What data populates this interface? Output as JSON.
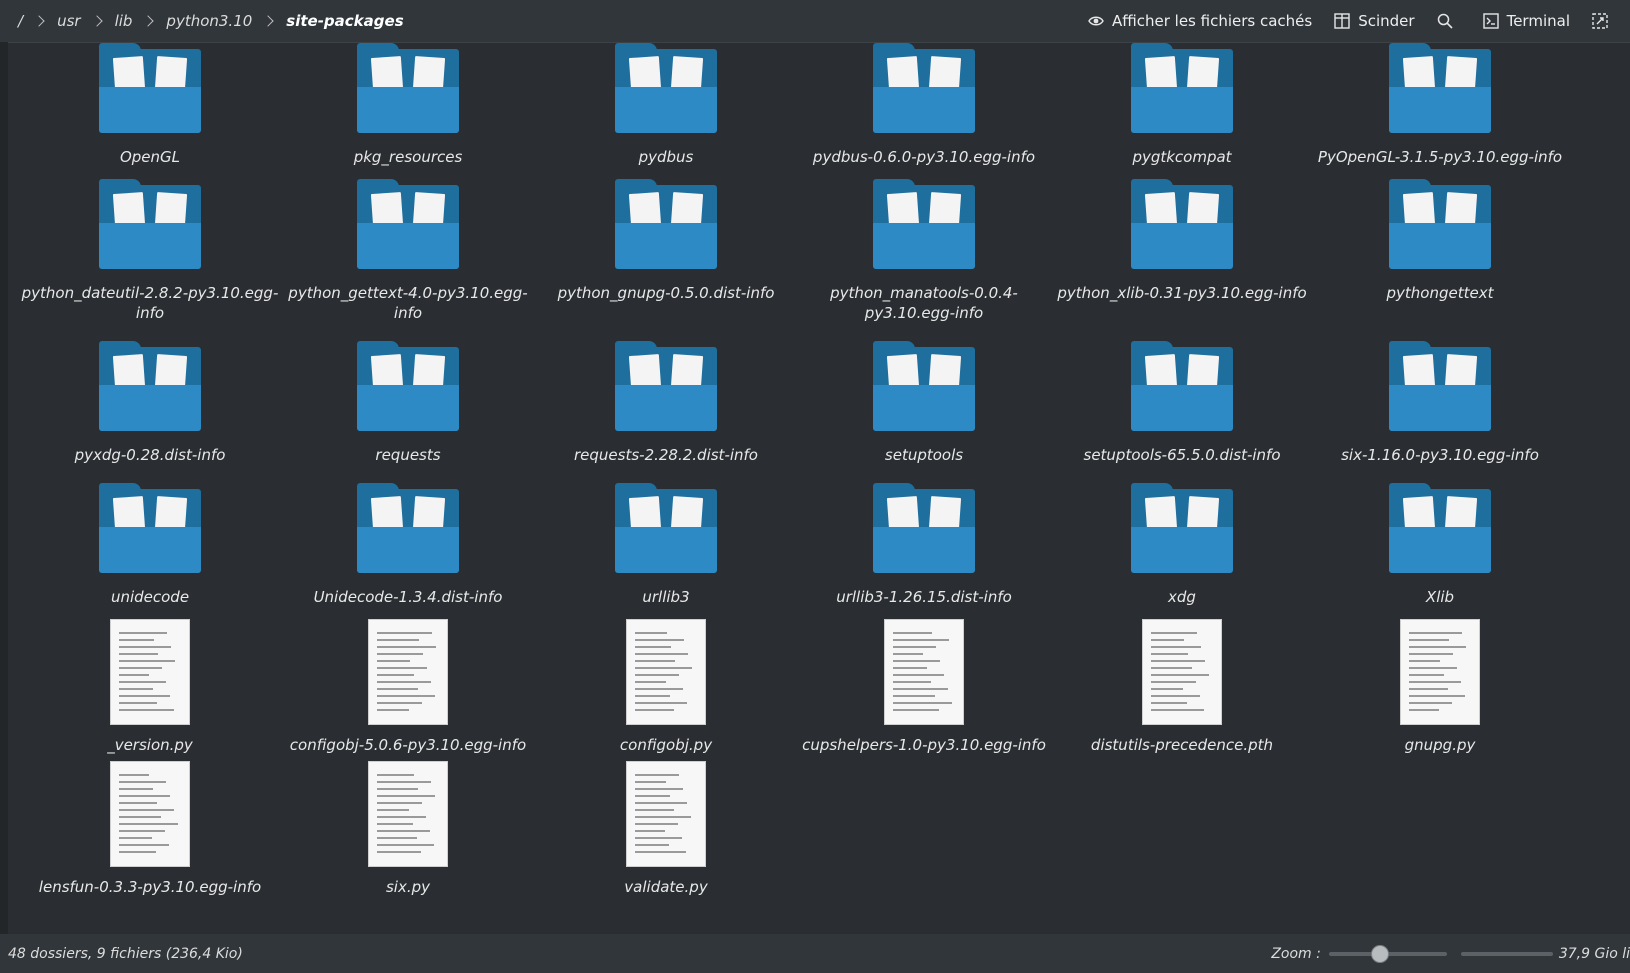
{
  "toolbar": {
    "breadcrumbs": [
      "/",
      "usr",
      "lib",
      "python3.10",
      "site-packages"
    ],
    "show_hidden_label": "Afficher les fichiers cachés",
    "split_label": "Scinder",
    "terminal_label": "Terminal"
  },
  "items": [
    {
      "name": "OpenGL",
      "type": "folder"
    },
    {
      "name": "pkg_resources",
      "type": "folder"
    },
    {
      "name": "pydbus",
      "type": "folder"
    },
    {
      "name": "pydbus-0.6.0-py3.10.egg-info",
      "type": "folder"
    },
    {
      "name": "pygtkcompat",
      "type": "folder"
    },
    {
      "name": "PyOpenGL-3.1.5-py3.10.egg-info",
      "type": "folder"
    },
    {
      "name": "python_dateutil-2.8.2-py3.10.egg-info",
      "type": "folder"
    },
    {
      "name": "python_gettext-4.0-py3.10.egg-info",
      "type": "folder"
    },
    {
      "name": "python_gnupg-0.5.0.dist-info",
      "type": "folder"
    },
    {
      "name": "python_manatools-0.0.4-py3.10.egg-info",
      "type": "folder"
    },
    {
      "name": "python_xlib-0.31-py3.10.egg-info",
      "type": "folder"
    },
    {
      "name": "pythongettext",
      "type": "folder"
    },
    {
      "name": "pyxdg-0.28.dist-info",
      "type": "folder"
    },
    {
      "name": "requests",
      "type": "folder"
    },
    {
      "name": "requests-2.28.2.dist-info",
      "type": "folder"
    },
    {
      "name": "setuptools",
      "type": "folder"
    },
    {
      "name": "setuptools-65.5.0.dist-info",
      "type": "folder"
    },
    {
      "name": "six-1.16.0-py3.10.egg-info",
      "type": "folder"
    },
    {
      "name": "unidecode",
      "type": "folder"
    },
    {
      "name": "Unidecode-1.3.4.dist-info",
      "type": "folder"
    },
    {
      "name": "urllib3",
      "type": "folder"
    },
    {
      "name": "urllib3-1.26.15.dist-info",
      "type": "folder"
    },
    {
      "name": "xdg",
      "type": "folder"
    },
    {
      "name": "Xlib",
      "type": "folder"
    },
    {
      "name": "_version.py",
      "type": "file"
    },
    {
      "name": "configobj-5.0.6-py3.10.egg-info",
      "type": "file"
    },
    {
      "name": "configobj.py",
      "type": "file"
    },
    {
      "name": "cupshelpers-1.0-py3.10.egg-info",
      "type": "file"
    },
    {
      "name": "distutils-precedence.pth",
      "type": "file"
    },
    {
      "name": "gnupg.py",
      "type": "file"
    },
    {
      "name": "lensfun-0.3.3-py3.10.egg-info",
      "type": "file"
    },
    {
      "name": "six.py",
      "type": "file"
    },
    {
      "name": "validate.py",
      "type": "file"
    }
  ],
  "statusbar": {
    "summary": "48 dossiers, 9 fichiers (236,4 Kio)",
    "zoom_label": "Zoom :",
    "free_space": "37,9 Gio li"
  },
  "colors": {
    "folder_back": "#1e6e9e",
    "folder_front": "#2d8ac4",
    "background": "#2a2e32",
    "toolbar": "#31363b"
  }
}
